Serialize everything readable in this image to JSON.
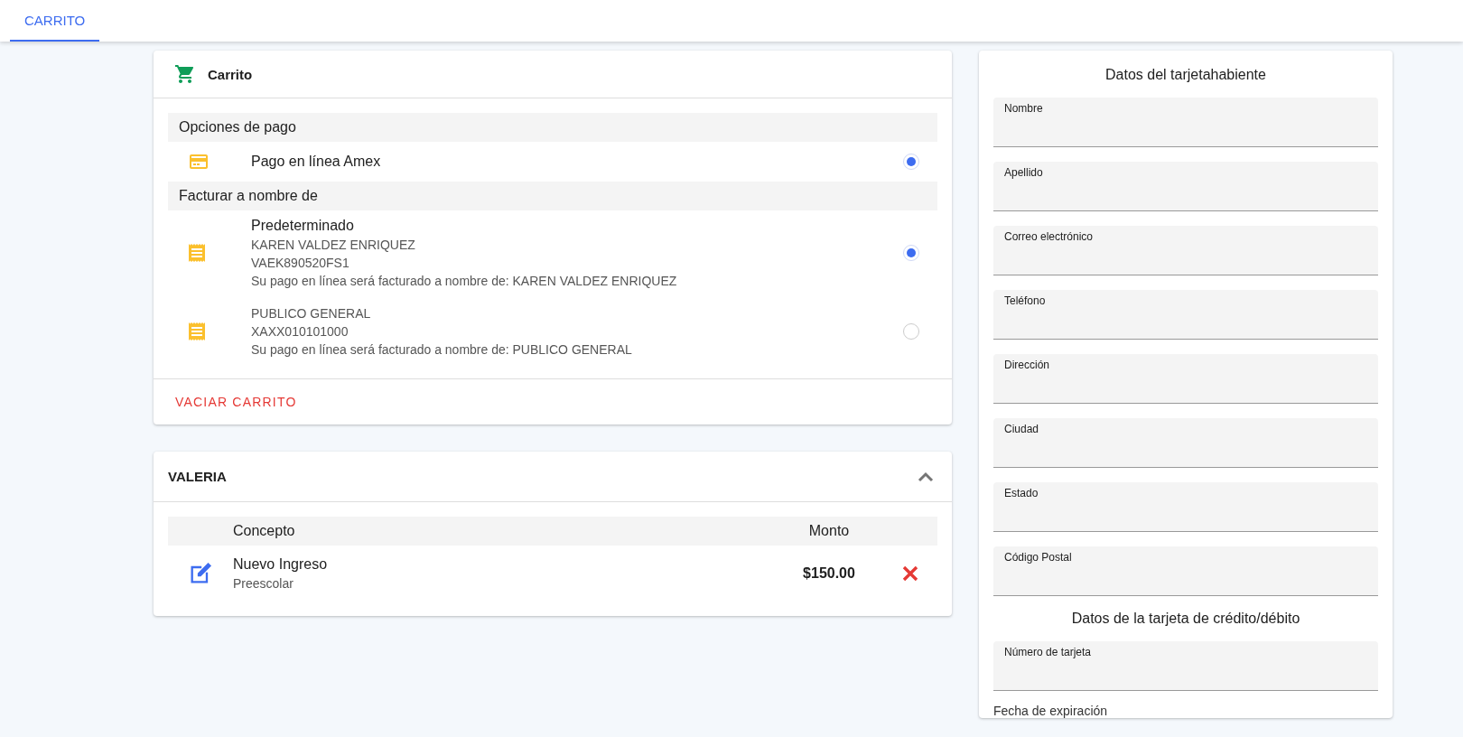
{
  "tabs": [
    {
      "label": "CARRITO",
      "selected": true
    }
  ],
  "cart": {
    "title": "Carrito",
    "payment_section": {
      "title": "Opciones de pago",
      "options": [
        {
          "label": "Pago en línea Amex",
          "selected": true
        }
      ]
    },
    "billing_section": {
      "title": "Facturar a nombre de",
      "options": [
        {
          "title": "Predeterminado",
          "lines": [
            "KAREN VALDEZ ENRIQUEZ",
            "VAEK890520FS1",
            "Su pago en línea será facturado a nombre de: KAREN VALDEZ ENRIQUEZ"
          ],
          "selected": true
        },
        {
          "lines": [
            "PUBLICO GENERAL",
            "XAXX010101000",
            "Su pago en línea será facturado a nombre de: PUBLICO GENERAL"
          ],
          "selected": false
        }
      ]
    },
    "empty_button": "VACIAR CARRITO"
  },
  "student": {
    "name": "VALERIA",
    "expanded": true,
    "columns": [
      "Concepto",
      "Monto"
    ],
    "rows": [
      {
        "concept": "Nuevo Ingreso",
        "detail": "Preescolar",
        "amount": "$150.00"
      }
    ]
  },
  "cardholder": {
    "title": "Datos del tarjetahabiente",
    "fields": [
      "Nombre",
      "Apellido",
      "Correo electrónico",
      "Teléfono",
      "Dirección",
      "Ciudad",
      "Estado",
      "Código Postal"
    ]
  },
  "card": {
    "title": "Datos de la tarjeta de crédito/débito",
    "fields": [
      "Número de tarjeta"
    ],
    "expiry_label": "Fecha de expiración"
  }
}
